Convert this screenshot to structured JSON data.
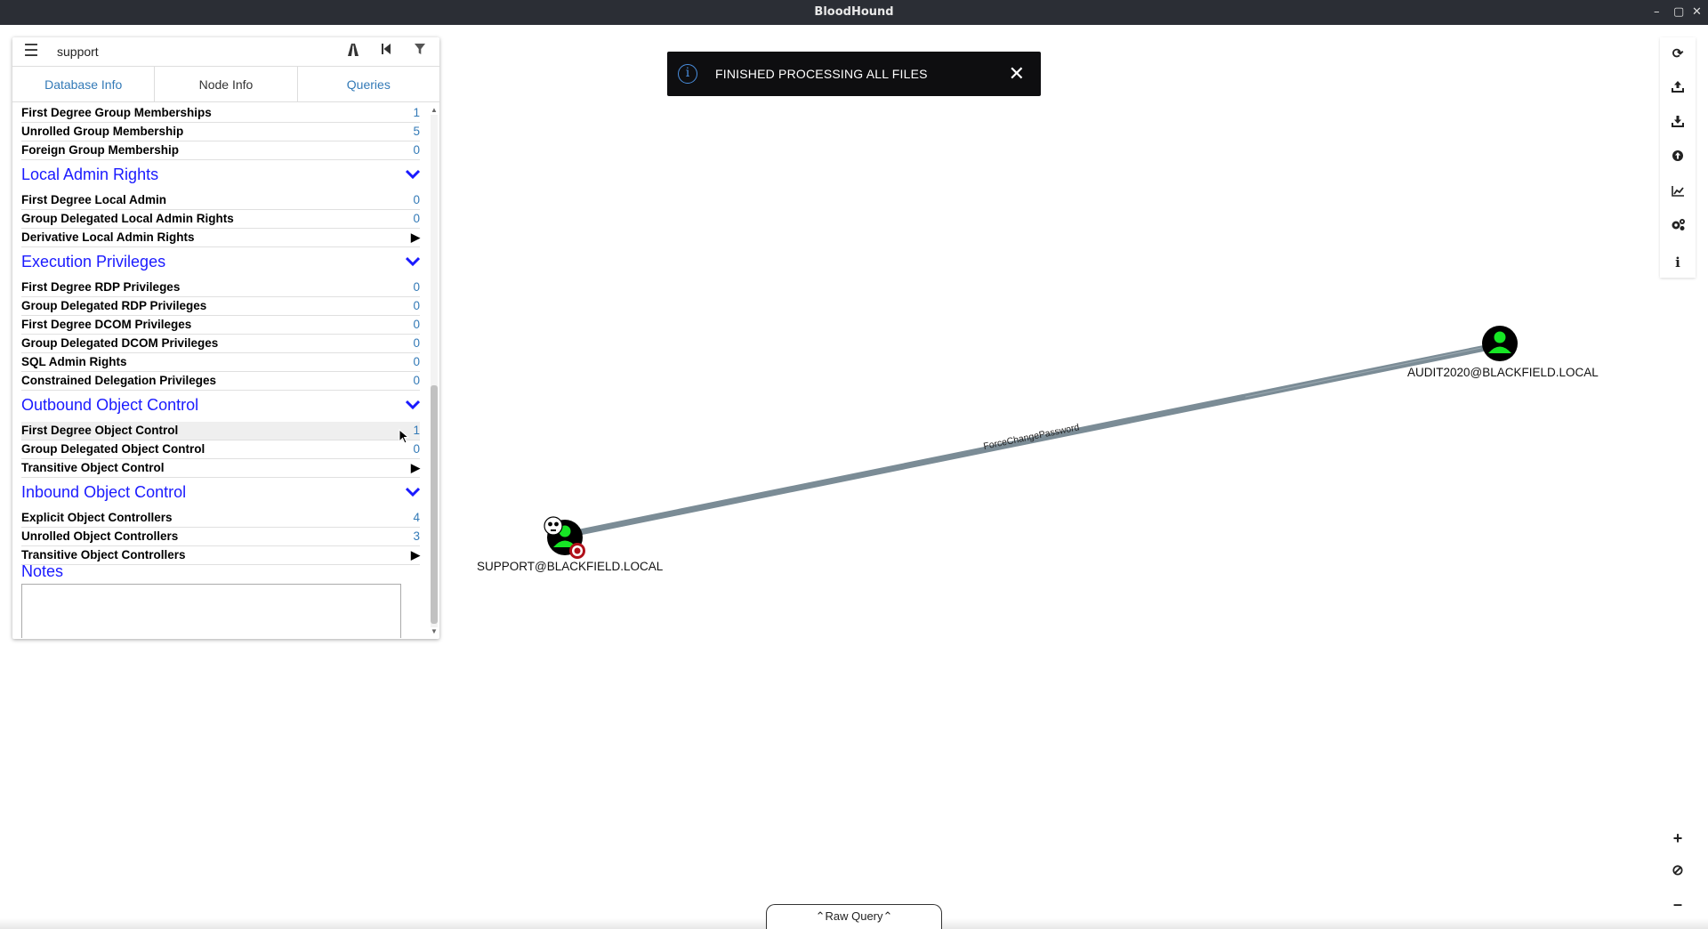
{
  "window": {
    "title": "BloodHound",
    "controls": [
      "–",
      "▢",
      "✕"
    ]
  },
  "search": {
    "value": "support",
    "placeholder": ""
  },
  "tabs": [
    {
      "label": "Database Info",
      "active": false
    },
    {
      "label": "Node Info",
      "active": true
    },
    {
      "label": "Queries",
      "active": false
    }
  ],
  "node_info": {
    "group_rows": [
      {
        "label": "First Degree Group Memberships",
        "value": "1"
      },
      {
        "label": "Unrolled Group Membership",
        "value": "5"
      },
      {
        "label": "Foreign Group Membership",
        "value": "0"
      }
    ],
    "local_admin": {
      "title": "Local Admin Rights",
      "rows": [
        {
          "label": "First Degree Local Admin",
          "value": "0"
        },
        {
          "label": "Group Delegated Local Admin Rights",
          "value": "0"
        },
        {
          "label": "Derivative Local Admin Rights",
          "value": "▶"
        }
      ]
    },
    "execution": {
      "title": "Execution Privileges",
      "rows": [
        {
          "label": "First Degree RDP Privileges",
          "value": "0"
        },
        {
          "label": "Group Delegated RDP Privileges",
          "value": "0"
        },
        {
          "label": "First Degree DCOM Privileges",
          "value": "0"
        },
        {
          "label": "Group Delegated DCOM Privileges",
          "value": "0"
        },
        {
          "label": "SQL Admin Rights",
          "value": "0"
        },
        {
          "label": "Constrained Delegation Privileges",
          "value": "0"
        }
      ]
    },
    "outbound": {
      "title": "Outbound Object Control",
      "rows": [
        {
          "label": "First Degree Object Control",
          "value": "1"
        },
        {
          "label": "Group Delegated Object Control",
          "value": "0"
        },
        {
          "label": "Transitive Object Control",
          "value": "▶"
        }
      ]
    },
    "inbound": {
      "title": "Inbound Object Control",
      "rows": [
        {
          "label": "Explicit Object Controllers",
          "value": "4"
        },
        {
          "label": "Unrolled Object Controllers",
          "value": "3"
        },
        {
          "label": "Transitive Object Controllers",
          "value": "▶"
        }
      ]
    },
    "notes_title": "Notes",
    "notes_value": ""
  },
  "toast": {
    "message": "FINISHED PROCESSING ALL FILES"
  },
  "graph": {
    "nodes": [
      {
        "id": "support",
        "label": "SUPPORT@BLACKFIELD.LOCAL"
      },
      {
        "id": "audit",
        "label": "AUDIT2020@BLACKFIELD.LOCAL"
      }
    ],
    "edge": {
      "label": "ForceChangePassword"
    }
  },
  "right_toolbar": [
    "refresh-icon",
    "upload-icon",
    "download-icon",
    "upload-circle-icon",
    "chart-icon",
    "gears-icon",
    "info-icon"
  ],
  "zoom": {
    "plus": "+",
    "reset": "⊘",
    "minus": "–"
  },
  "raw_query": {
    "label": "Raw Query"
  },
  "colors": {
    "user_node": "#17e625",
    "edge": "#7b8c96",
    "section_title": "#1a1aff",
    "link": "#337ab7"
  }
}
